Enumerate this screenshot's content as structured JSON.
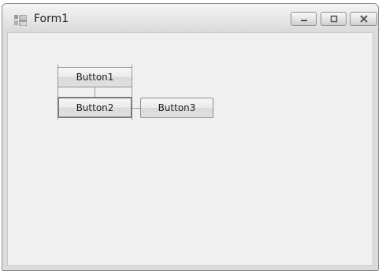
{
  "window": {
    "title": "Form1"
  },
  "title_bar": {
    "icon": "form-icon",
    "buttons": [
      "minimize-icon",
      "maximize-icon",
      "close-icon"
    ]
  },
  "form": {
    "buttons": [
      {
        "label": "Button1"
      },
      {
        "label": "Button2"
      },
      {
        "label": "Button3"
      }
    ]
  },
  "colors": {
    "client_background": "#f0f0f0",
    "titlebar_background": "#e6e6e6"
  }
}
